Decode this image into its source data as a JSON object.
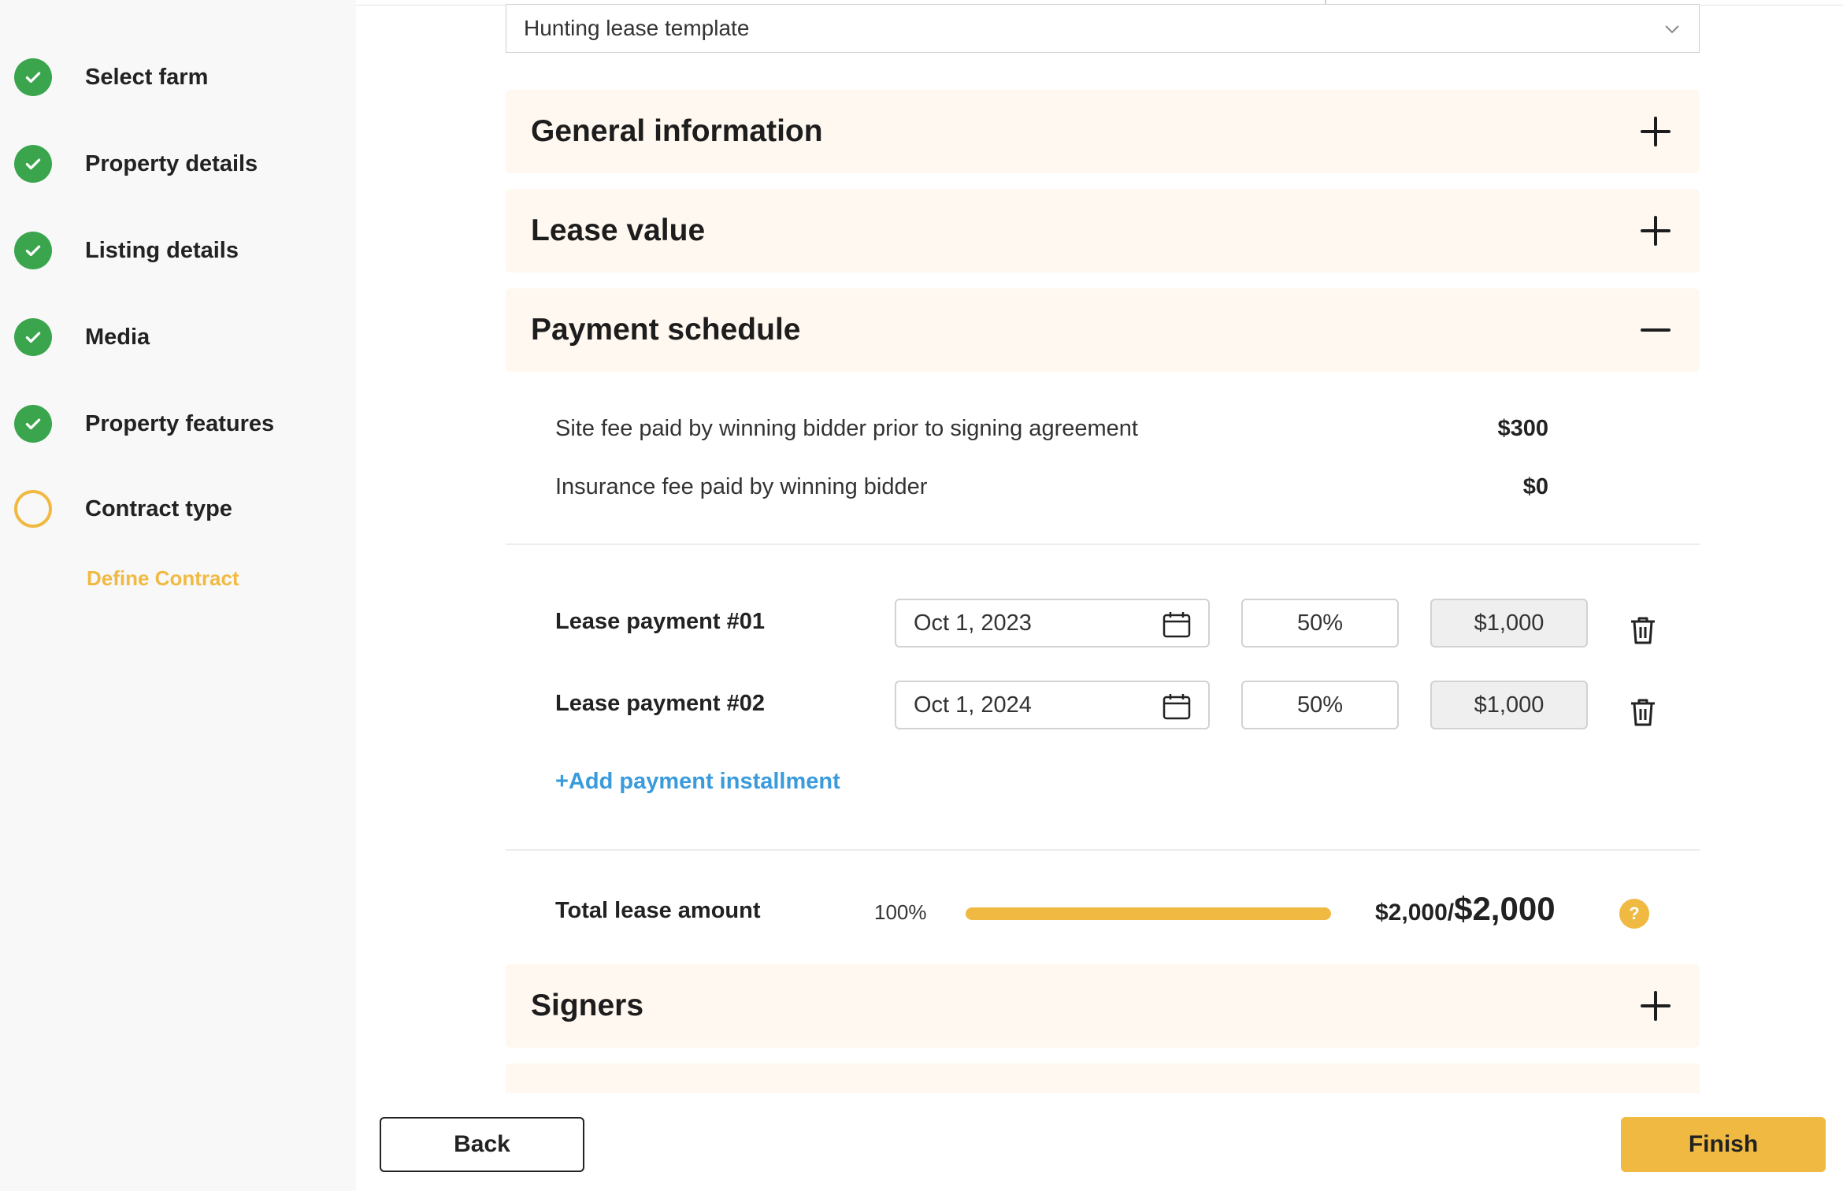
{
  "colors": {
    "accent": "#f0b942",
    "done": "#3aa54d",
    "link": "#3a9bdc",
    "section_bg": "#fff8f0"
  },
  "sidebar": {
    "steps": [
      {
        "label": "Select farm",
        "status": "done"
      },
      {
        "label": "Property details",
        "status": "done"
      },
      {
        "label": "Listing details",
        "status": "done"
      },
      {
        "label": "Media",
        "status": "done"
      },
      {
        "label": "Property features",
        "status": "done"
      },
      {
        "label": "Contract type",
        "status": "current"
      }
    ],
    "substep": "Define Contract"
  },
  "template_select": {
    "value": "Hunting lease template",
    "icon": "chevron-down-icon"
  },
  "sections": {
    "general": {
      "title": "General information",
      "state": "collapsed"
    },
    "lease_value": {
      "title": "Lease value",
      "state": "collapsed"
    },
    "payment_schedule": {
      "title": "Payment schedule",
      "state": "expanded"
    },
    "signers": {
      "title": "Signers",
      "state": "collapsed"
    }
  },
  "fees": [
    {
      "label": "Site fee paid by winning bidder prior to signing agreement",
      "value": "$300"
    },
    {
      "label": "Insurance fee paid by winning bidder",
      "value": "$0"
    }
  ],
  "payments": [
    {
      "label": "Lease payment #01",
      "date": "Oct 1, 2023",
      "percent": "50%",
      "amount": "$1,000"
    },
    {
      "label": "Lease payment #02",
      "date": "Oct 1, 2024",
      "percent": "50%",
      "amount": "$1,000"
    }
  ],
  "add_payment": "+Add payment installment",
  "total": {
    "label": "Total lease amount",
    "percent_text": "100%",
    "progress": 1.0,
    "amount_allocated": "$2,000/",
    "amount_total": "$2,000",
    "help_symbol": "?"
  },
  "footer": {
    "back": "Back",
    "finish": "Finish"
  }
}
